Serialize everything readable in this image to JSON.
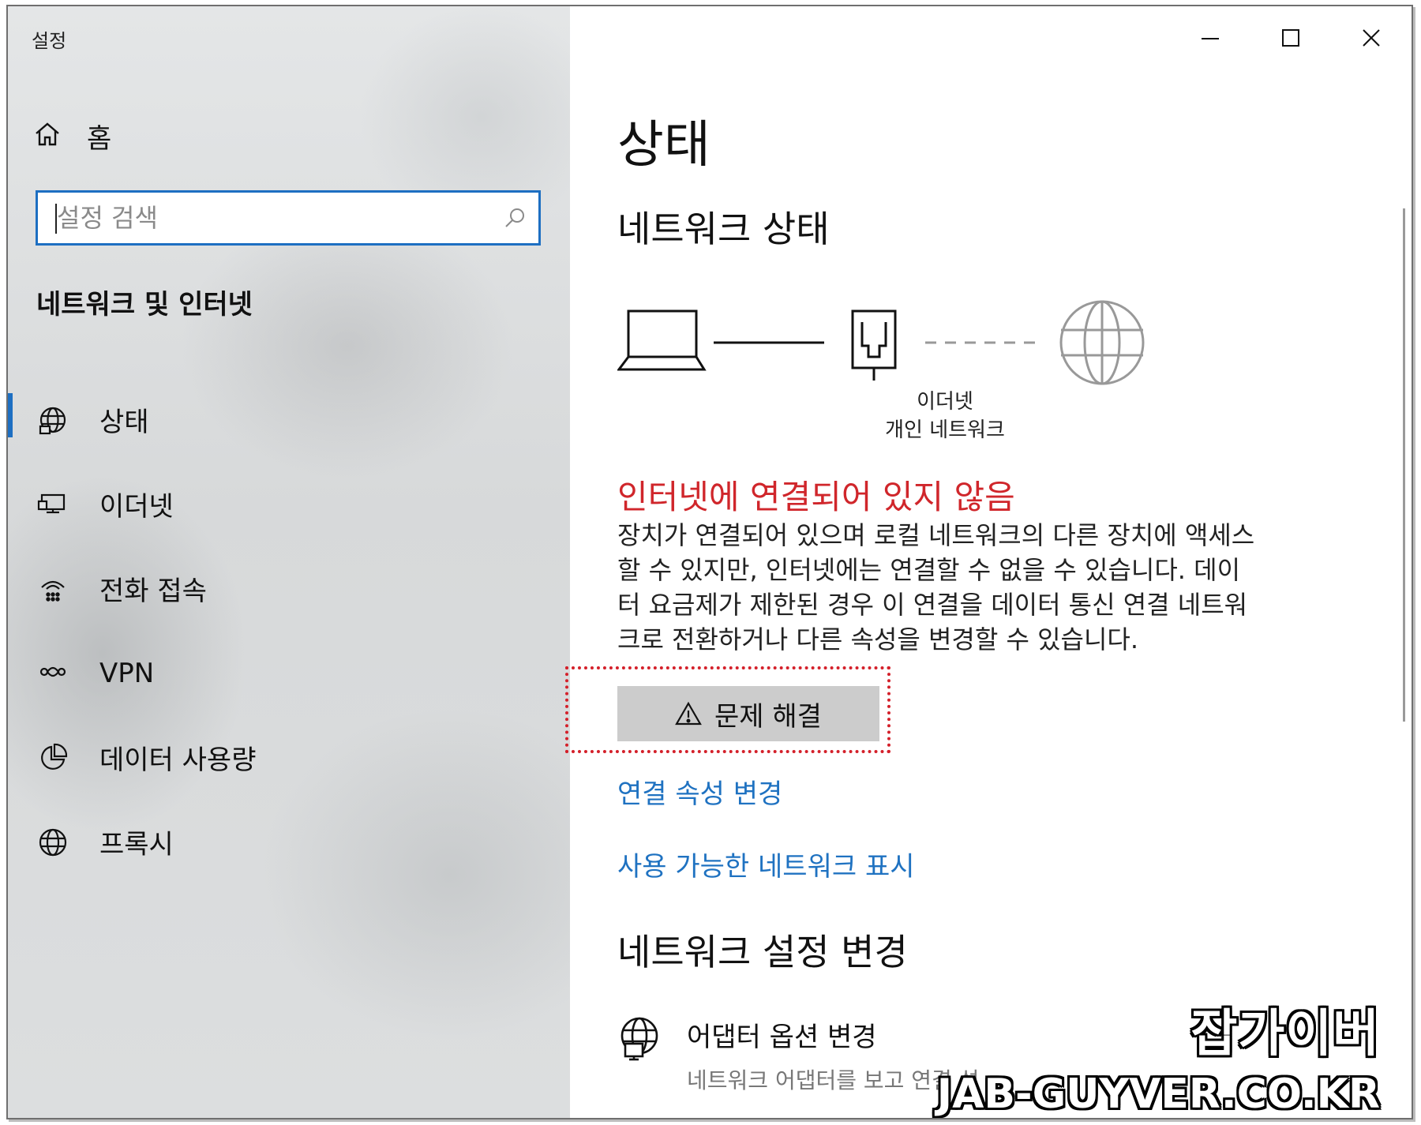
{
  "window": {
    "title": "설정",
    "controls": {
      "minimize": "minimize",
      "maximize": "maximize",
      "close": "close"
    }
  },
  "sidebar": {
    "home_label": "홈",
    "search_placeholder": "설정 검색",
    "section_title": "네트워크 및 인터넷",
    "items": [
      {
        "label": "상태",
        "icon": "globe-status-icon",
        "active": true
      },
      {
        "label": "이더넷",
        "icon": "ethernet-icon"
      },
      {
        "label": "전화 접속",
        "icon": "dial-up-icon"
      },
      {
        "label": "VPN",
        "icon": "vpn-icon"
      },
      {
        "label": "데이터 사용량",
        "icon": "data-usage-icon"
      },
      {
        "label": "프록시",
        "icon": "globe-icon"
      }
    ]
  },
  "main": {
    "page_title": "상태",
    "network_status_heading": "네트워크 상태",
    "diagram": {
      "adapter_name": "이더넷",
      "network_type": "개인 네트워크"
    },
    "status_message": "인터넷에 연결되어 있지 않음",
    "description_lines": [
      "장치가 연결되어 있으며 로컬 네트워크의 다른 장치에 액세스",
      "할 수 있지만, 인터넷에는 연결할 수 없을 수 있습니다. 데이",
      "터 요금제가 제한된 경우 이 연결을 데이터 통신 연결 네트워",
      "크로 전환하거나 다른 속성을 변경할 수 있습니다."
    ],
    "troubleshoot_label": "문제 해결",
    "link_change_properties": "연결 속성 변경",
    "link_show_networks": "사용 가능한 네트워크 표시",
    "change_settings_heading": "네트워크 설정 변경",
    "adapter_options": {
      "title": "어댑터 옵션 변경",
      "subtitle": "네트워크 어댑터를 보고 연결 설"
    }
  },
  "watermark": {
    "korean": "잡가이버",
    "domain": "JAB-GUYVER.CO.KR"
  },
  "colors": {
    "accent": "#1d6fc2",
    "link": "#1f72c1",
    "error": "#d0262b",
    "highlight_outline": "#d4202a",
    "button_bg": "#cccccc"
  }
}
